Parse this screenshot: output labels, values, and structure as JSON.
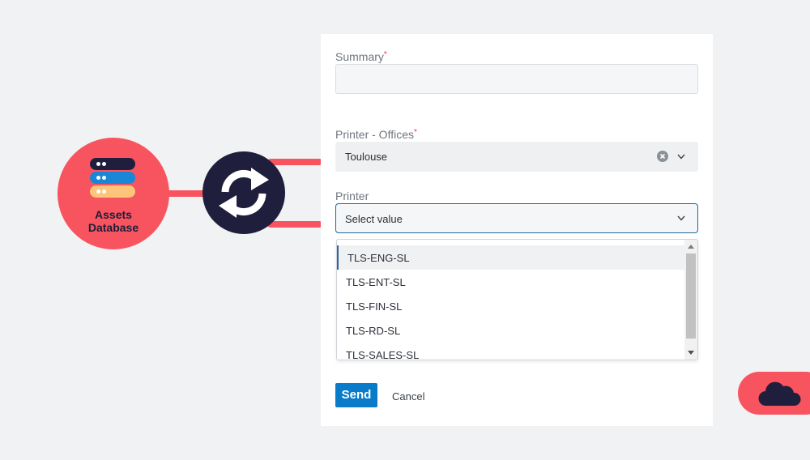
{
  "diagram": {
    "db_label_line1": "Assets",
    "db_label_line2": "Database"
  },
  "form": {
    "summary": {
      "label": "Summary",
      "required_mark": "*",
      "value": ""
    },
    "offices": {
      "label": "Printer - Offices",
      "required_mark": "*",
      "value": "Toulouse"
    },
    "printer": {
      "label": "Printer",
      "placeholder": "Select value",
      "options": [
        "TLS-ENG-SL",
        "TLS-ENT-SL",
        "TLS-FIN-SL",
        "TLS-RD-SL",
        "TLS-SALES-SL"
      ]
    },
    "send_label": "Send",
    "cancel_label": "Cancel"
  },
  "colors": {
    "accent_red": "#f7545f",
    "navy": "#1f1f3d",
    "send_blue": "#0a7bc8",
    "focus_border": "#1d6a9a"
  }
}
